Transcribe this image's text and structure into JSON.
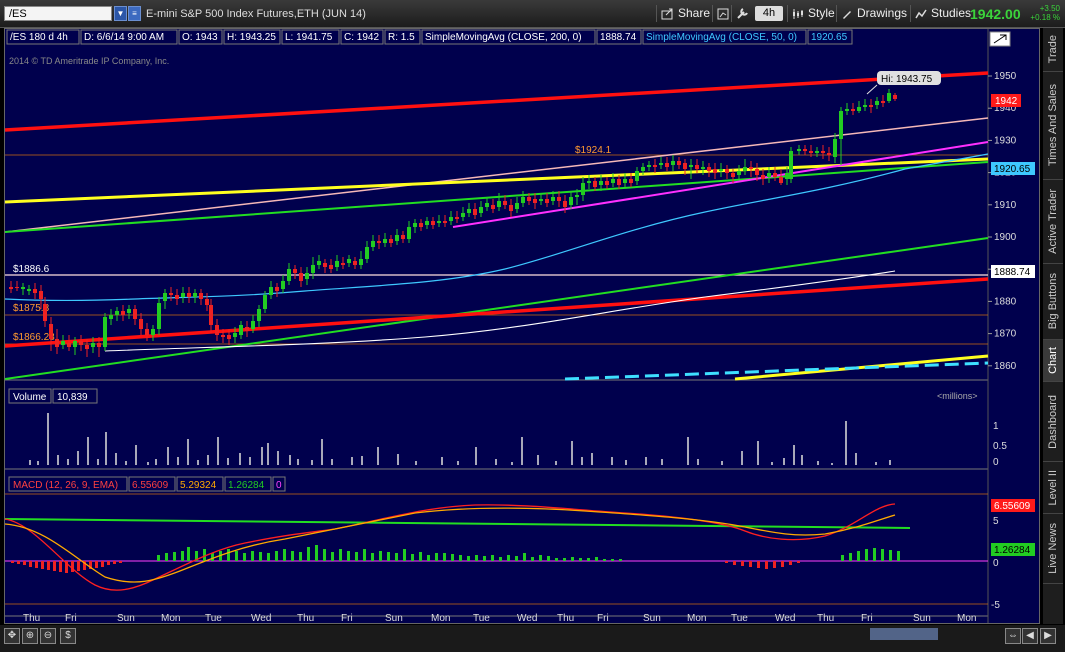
{
  "toolbar": {
    "symbol": "/ES",
    "description": "E-mini S&P 500 Index Futures,ETH (JUN 14)",
    "share": "Share",
    "timeframe": "4h",
    "style": "Style",
    "drawings": "Drawings",
    "studies": "Studies",
    "last_price": "1942.00",
    "change_abs": "+3.50",
    "change_pct": "+0.18 %"
  },
  "header": {
    "symbol_tf": "/ES 180 d 4h",
    "date": "D: 6/6/14 9:00 AM",
    "open": "O: 1943",
    "high": "H: 1943.25",
    "low": "L: 1941.75",
    "close": "C: 1942",
    "range": "R: 1.5",
    "sma200_label": "SimpleMovingAvg (CLOSE, 200, 0)",
    "sma200_value": "1888.74",
    "sma50_label": "SimpleMovingAvg (CLOSE, 50, 0)",
    "sma50_value": "1920.65",
    "copyright": "2014 © TD Ameritrade IP Company, Inc."
  },
  "price_labels": {
    "hi": "Hi: 1943.75",
    "current": "1942",
    "sma50": "1920.65",
    "sma200": "1888.74",
    "lvl1924": "$1924.1",
    "lvl1886": "$1886.6",
    "lvl1875": "$1875.3",
    "lvl1866": "$1866.28"
  },
  "volume": {
    "label": "Volume",
    "value": "10,839",
    "units": "<millions>",
    "scale": [
      "1",
      "0.5",
      "0"
    ]
  },
  "macd": {
    "label": "MACD (12, 26, 9, EMA)",
    "value": "6.55609",
    "avg": "5.29324",
    "diff": "1.26284",
    "zero": "0",
    "scale": [
      "5",
      "0",
      "-5"
    ],
    "badge_value": "6.55609",
    "badge_diff": "1.26284"
  },
  "price_axis": [
    "1950",
    "1940",
    "1930",
    "1920",
    "1910",
    "1900",
    "1890",
    "1880",
    "1870",
    "1860"
  ],
  "time_axis": [
    "Thu",
    "Fri",
    "Sun",
    "Mon",
    "Tue",
    "Wed",
    "Thu",
    "Fri",
    "Sun",
    "Mon",
    "Tue",
    "Wed",
    "Thu",
    "Fri",
    "Sun",
    "Mon",
    "Tue",
    "Wed",
    "Thu",
    "Fri",
    "Sun",
    "Mon"
  ],
  "sidebar": [
    "Trade",
    "Times And Sales",
    "Active Trader",
    "Big Buttons",
    "Chart",
    "Dashboard",
    "Level II",
    "Live News"
  ],
  "bottom": {
    "dollar": "$"
  },
  "colors": {
    "background": "#00004d",
    "up": "#22cc22",
    "down": "#ee2222",
    "sma50": "#3ec8ff",
    "sma200": "#ffffff",
    "macd_value": "#ff2020",
    "macd_avg": "#ffaa00",
    "macd_diff": "#22cc22"
  }
}
